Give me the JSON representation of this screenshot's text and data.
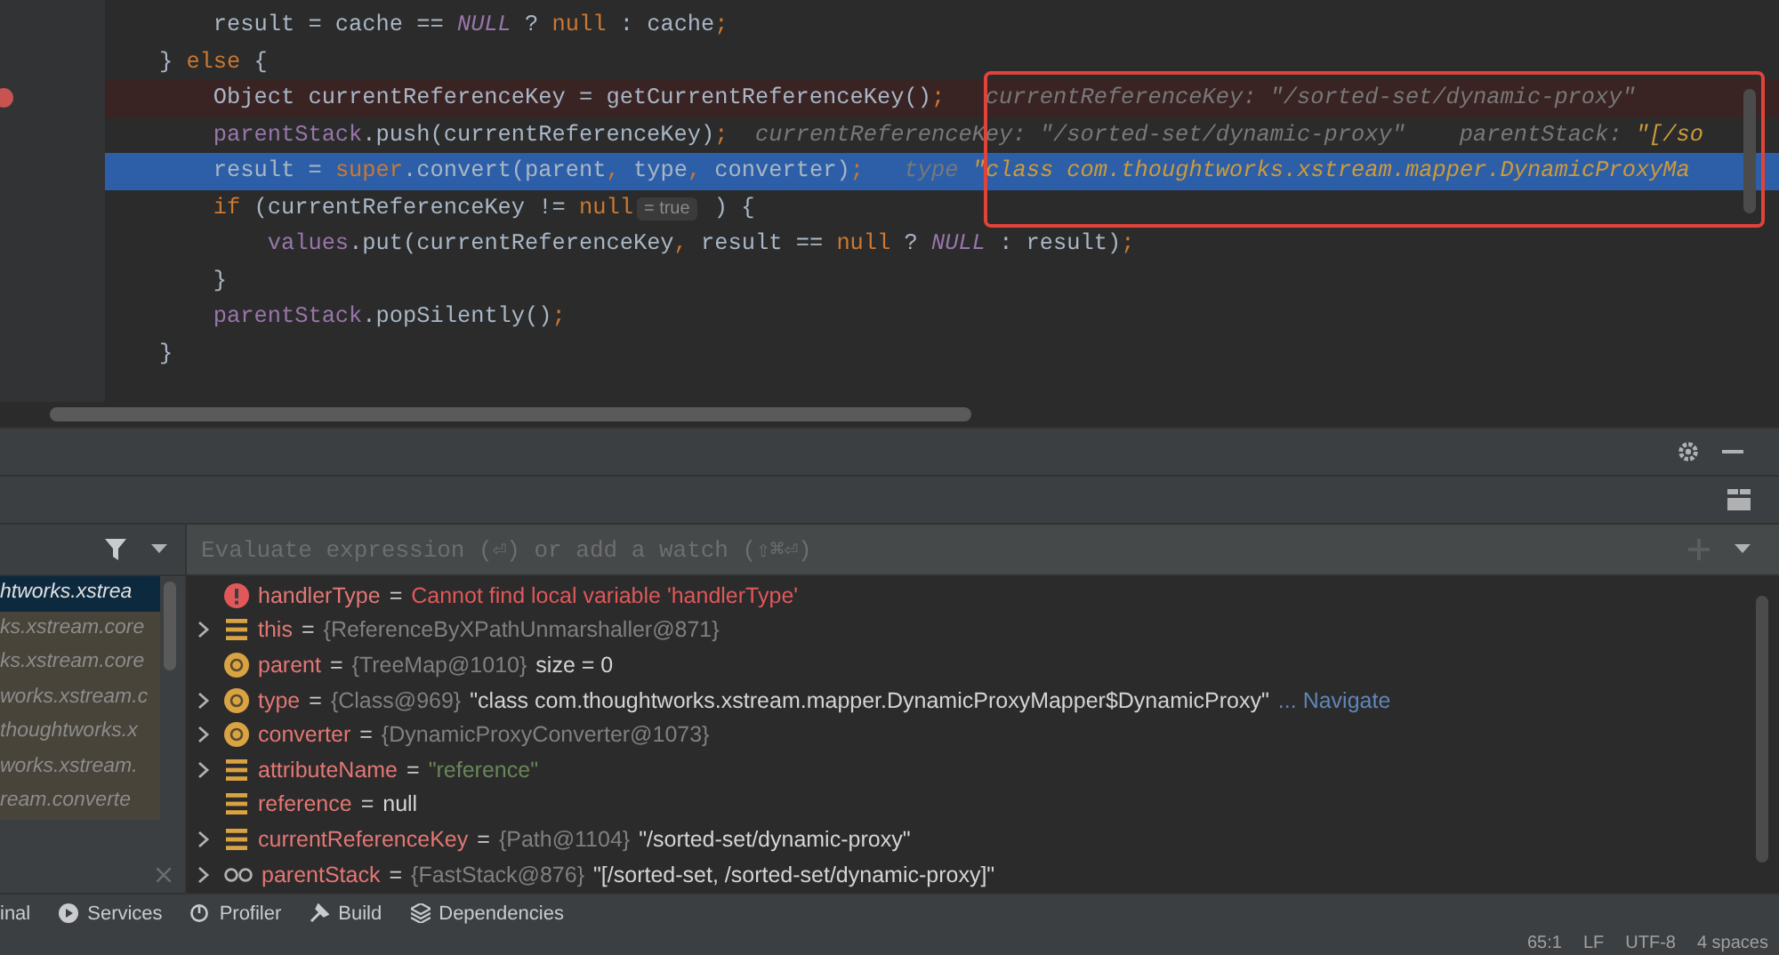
{
  "editor": {
    "lines": [
      {
        "breakpoint": false,
        "current": false,
        "segments": [
          {
            "kind": "plain",
            "text": "        result = cache == "
          },
          {
            "kind": "constant",
            "text": "NULL"
          },
          {
            "kind": "plain",
            "text": " ? "
          },
          {
            "kind": "keyword",
            "text": "null"
          },
          {
            "kind": "plain",
            "text": " : cache"
          },
          {
            "kind": "keyword",
            "text": ";"
          }
        ]
      },
      {
        "breakpoint": false,
        "current": false,
        "segments": [
          {
            "kind": "plain",
            "text": "    } "
          },
          {
            "kind": "keyword",
            "text": "else"
          },
          {
            "kind": "plain",
            "text": " {"
          }
        ]
      },
      {
        "breakpoint": true,
        "current": false,
        "segments": [
          {
            "kind": "plain",
            "text": "        Object currentReferenceKey = getCurrentReferenceKey()"
          },
          {
            "kind": "keyword",
            "text": ";"
          },
          {
            "kind": "hint",
            "text": "   currentReferenceKey: \"/sorted-set/dynamic-proxy\""
          }
        ]
      },
      {
        "breakpoint": false,
        "current": false,
        "segments": [
          {
            "kind": "field",
            "text": "        parentStack"
          },
          {
            "kind": "plain",
            "text": ".push(currentReferenceKey)"
          },
          {
            "kind": "keyword",
            "text": ";"
          },
          {
            "kind": "hint",
            "text": "  currentReferenceKey: \"/sorted-set/dynamic-proxy\"    parentStack: "
          },
          {
            "kind": "hintvalue",
            "text": "\"[/so"
          }
        ]
      },
      {
        "breakpoint": false,
        "current": true,
        "segments": [
          {
            "kind": "plain",
            "text": "        result = "
          },
          {
            "kind": "keyword",
            "text": "super"
          },
          {
            "kind": "plain",
            "text": ".convert(parent"
          },
          {
            "kind": "keyword",
            "text": ","
          },
          {
            "kind": "plain",
            "text": " type"
          },
          {
            "kind": "keyword",
            "text": ","
          },
          {
            "kind": "plain",
            "text": " converter)"
          },
          {
            "kind": "keyword",
            "text": ";"
          },
          {
            "kind": "hint",
            "text": "   type "
          },
          {
            "kind": "hintvalue",
            "text": "\"class com.thoughtworks.xstream.mapper.DynamicProxyMa"
          }
        ]
      },
      {
        "breakpoint": false,
        "current": false,
        "segments": [
          {
            "kind": "keyword",
            "text": "        if"
          },
          {
            "kind": "plain",
            "text": " (currentReferenceKey != "
          },
          {
            "kind": "keyword",
            "text": "null"
          },
          {
            "kind": "badge",
            "text": "= true"
          },
          {
            "kind": "plain",
            "text": " ) {"
          }
        ]
      },
      {
        "breakpoint": false,
        "current": false,
        "segments": [
          {
            "kind": "field",
            "text": "            values"
          },
          {
            "kind": "plain",
            "text": ".put(currentReferenceKey"
          },
          {
            "kind": "keyword",
            "text": ","
          },
          {
            "kind": "plain",
            "text": " result == "
          },
          {
            "kind": "keyword",
            "text": "null"
          },
          {
            "kind": "plain",
            "text": " ? "
          },
          {
            "kind": "constant",
            "text": "NULL"
          },
          {
            "kind": "plain",
            "text": " : result)"
          },
          {
            "kind": "keyword",
            "text": ";"
          }
        ]
      },
      {
        "breakpoint": false,
        "current": false,
        "segments": [
          {
            "kind": "plain",
            "text": "        }"
          }
        ]
      },
      {
        "breakpoint": false,
        "current": false,
        "segments": [
          {
            "kind": "field",
            "text": "        parentStack"
          },
          {
            "kind": "plain",
            "text": ".popSilently()"
          },
          {
            "kind": "keyword",
            "text": ";"
          }
        ]
      },
      {
        "breakpoint": false,
        "current": false,
        "segments": [
          {
            "kind": "plain",
            "text": "    }"
          }
        ]
      }
    ]
  },
  "frames": {
    "items": [
      {
        "label": "htworks.xstrea",
        "selected": true
      },
      {
        "label": "ks.xstream.core",
        "selected": false
      },
      {
        "label": "ks.xstream.core",
        "selected": false
      },
      {
        "label": "works.xstream.c",
        "selected": false
      },
      {
        "label": "thoughtworks.x",
        "selected": false
      },
      {
        "label": "works.xstream.",
        "selected": false
      },
      {
        "label": "ream.converte",
        "selected": false
      }
    ]
  },
  "evaluate": {
    "placeholder": "Evaluate expression (⏎) or add a watch (⇧⌘⏎)"
  },
  "variables": [
    {
      "kind": "error",
      "expandable": false,
      "name": "handlerType",
      "equals": "=",
      "error": "Cannot find local variable 'handlerType'"
    },
    {
      "kind": "field",
      "expandable": true,
      "name": "this",
      "equals": "=",
      "ref": "{ReferenceByXPathUnmarshaller@871}"
    },
    {
      "kind": "param",
      "expandable": false,
      "name": "parent",
      "equals": "=",
      "ref": "{TreeMap@1010}",
      "value": "size = 0"
    },
    {
      "kind": "param",
      "expandable": true,
      "name": "type",
      "equals": "=",
      "ref": "{Class@969}",
      "value": "\"class com.thoughtworks.xstream.mapper.DynamicProxyMapper$DynamicProxy\"",
      "link": "... Navigate"
    },
    {
      "kind": "param",
      "expandable": true,
      "name": "converter",
      "equals": "=",
      "ref": "{DynamicProxyConverter@1073}"
    },
    {
      "kind": "field",
      "expandable": true,
      "name": "attributeName",
      "equals": "=",
      "string": "\"reference\""
    },
    {
      "kind": "field",
      "expandable": false,
      "name": "reference",
      "equals": "=",
      "value": "null"
    },
    {
      "kind": "field",
      "expandable": true,
      "name": "currentReferenceKey",
      "equals": "=",
      "ref": "{Path@1104}",
      "value": "\"/sorted-set/dynamic-proxy\""
    },
    {
      "kind": "watch",
      "expandable": true,
      "name": "parentStack",
      "equals": "=",
      "ref": "{FastStack@876}",
      "value": "\"[/sorted-set, /sorted-set/dynamic-proxy]\""
    }
  ],
  "tool_windows": [
    {
      "kind": "plain",
      "label": "inal"
    },
    {
      "kind": "services",
      "label": "Services"
    },
    {
      "kind": "profiler",
      "label": "Profiler"
    },
    {
      "kind": "build",
      "label": "Build"
    },
    {
      "kind": "dependencies",
      "label": "Dependencies"
    }
  ],
  "status_bar": [
    "65:1",
    "LF",
    "UTF-8",
    "4 spaces"
  ]
}
